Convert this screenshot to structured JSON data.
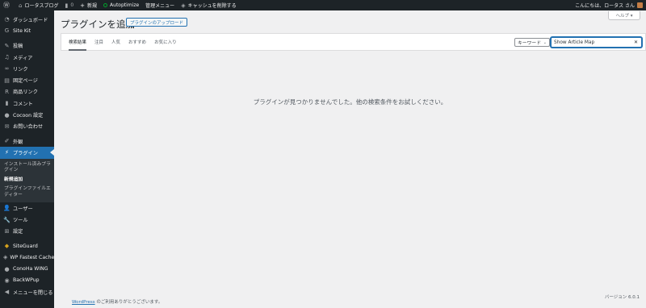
{
  "adminbar": {
    "wp_logo_icon": "wordpress-icon",
    "site_name": "ロータスブログ",
    "comments_count": "0",
    "new_label": "新規",
    "autoptimize_label": "Autoptimize",
    "admin_menu_label": "管理メニュー",
    "cache_clear_label": "キャッシュを削除する",
    "greeting": "こんにちは、ロータス さん"
  },
  "sidebar": {
    "items": [
      {
        "label": "ダッシュボード",
        "icon": "dashboard-icon"
      },
      {
        "label": "Site Kit",
        "icon": "google-icon"
      },
      {
        "label": "投稿",
        "icon": "pin-icon"
      },
      {
        "label": "メディア",
        "icon": "media-icon"
      },
      {
        "label": "リンク",
        "icon": "link-icon"
      },
      {
        "label": "固定ページ",
        "icon": "page-icon"
      },
      {
        "label": "商品リンク",
        "icon": "rakuten-icon"
      },
      {
        "label": "コメント",
        "icon": "comment-icon"
      },
      {
        "label": "Cocoon 設定",
        "icon": "cocoon-icon"
      },
      {
        "label": "お問い合わせ",
        "icon": "mail-icon"
      },
      {
        "label": "外観",
        "icon": "brush-icon"
      },
      {
        "label": "プラグイン",
        "icon": "plugin-icon"
      },
      {
        "label": "ユーザー",
        "icon": "user-icon"
      },
      {
        "label": "ツール",
        "icon": "wrench-icon"
      },
      {
        "label": "設定",
        "icon": "settings-icon"
      },
      {
        "label": "SiteGuard",
        "icon": "siteguard-icon"
      },
      {
        "label": "WP Fastest Cache",
        "icon": "cache-icon"
      },
      {
        "label": "ConoHa WING",
        "icon": "conoha-icon"
      },
      {
        "label": "BackWPup",
        "icon": "backwpup-icon"
      },
      {
        "label": "メニューを閉じる",
        "icon": "collapse-icon"
      }
    ],
    "submenu": [
      {
        "label": "インストール済みプラグイン"
      },
      {
        "label": "新規追加"
      },
      {
        "label": "プラグインファイルエディター"
      }
    ]
  },
  "main": {
    "help_label": "ヘルプ ▾",
    "title": "プラグインを追加",
    "upload_button": "プラグインのアップロード",
    "tabs": [
      "検索結果",
      "注目",
      "人気",
      "おすすめ",
      "お気に入り"
    ],
    "search_type": "キーワード",
    "search_value": "Show Article Map",
    "no_results": "プラグインが見つかりませんでした。他の検索条件をお試しください。"
  },
  "footer": {
    "wordpress_link": "WordPress",
    "thanks": " のご利用ありがとうございます。",
    "version": "バージョン 6.0.1"
  },
  "colors": {
    "adminbar_bg": "#1d2327",
    "accent": "#2271b1",
    "page_bg": "#f0f0f1"
  }
}
